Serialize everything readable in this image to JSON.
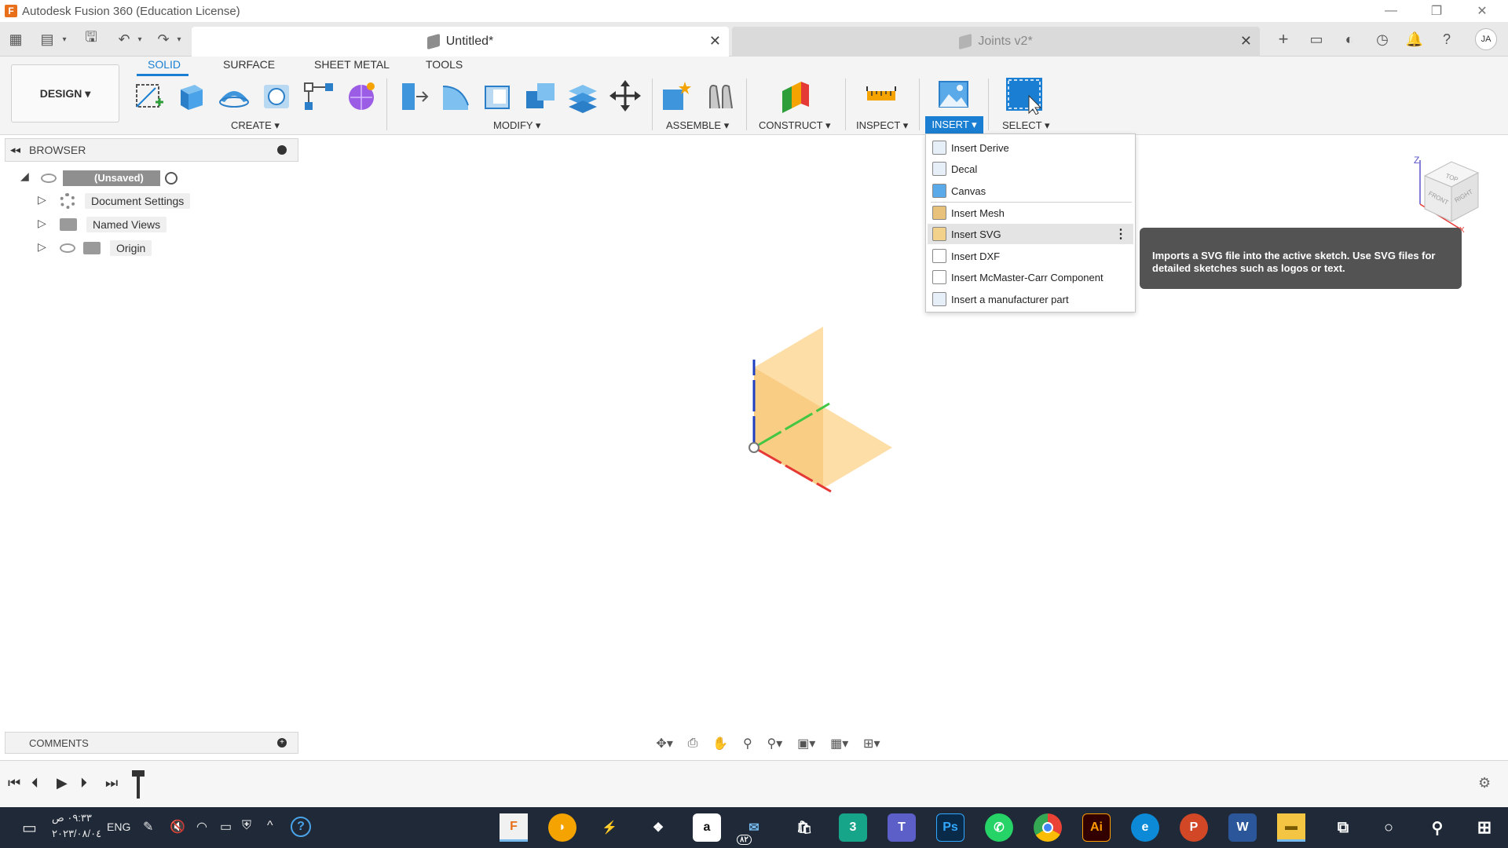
{
  "window": {
    "app_logo_letter": "F",
    "title": "Autodesk Fusion 360 (Education License)"
  },
  "tabs": [
    {
      "label": "Untitled*",
      "active": true
    },
    {
      "label": "Joints v2*",
      "active": false
    }
  ],
  "user": {
    "initials": "JA"
  },
  "ribbon": {
    "workspace": "DESIGN ▾",
    "tabs": [
      "SOLID",
      "SURFACE",
      "SHEET METAL",
      "TOOLS"
    ],
    "groups": {
      "create": "CREATE ▾",
      "modify": "MODIFY ▾",
      "assemble": "ASSEMBLE ▾",
      "construct": "CONSTRUCT ▾",
      "inspect": "INSPECT ▾",
      "insert": "INSERT ▾",
      "select": "SELECT ▾"
    }
  },
  "browser": {
    "title": "BROWSER",
    "root": "(Unsaved)",
    "items": [
      "Document Settings",
      "Named Views",
      "Origin"
    ]
  },
  "insert_menu": {
    "items": [
      "Insert Derive",
      "Decal",
      "Canvas",
      "Insert Mesh",
      "Insert SVG",
      "Insert DXF",
      "Insert McMaster-Carr Component",
      "Insert a manufacturer part"
    ],
    "highlighted": "Insert SVG"
  },
  "tooltip": {
    "text": "Imports a SVG file into the active sketch. Use SVG files for detailed sketches such as logos or text."
  },
  "viewcube": {
    "top": "TOP",
    "front": "FRONT",
    "right": "RIGHT",
    "z_axis": "Z",
    "x_axis": "X"
  },
  "comments": {
    "title": "COMMENTS"
  },
  "taskbar": {
    "time": "٠٩:٣٣ ص",
    "date": "٢٠٢٣/٠٨/٠٤",
    "language": "ENG",
    "mail_badge": "٨٢"
  },
  "colors": {
    "accent": "#1a7fd2",
    "plane": "#fcd38a",
    "axis_x": "#e53935",
    "axis_y": "#43c643",
    "axis_z": "#1e3fbf",
    "tooltip_bg": "#535353"
  }
}
